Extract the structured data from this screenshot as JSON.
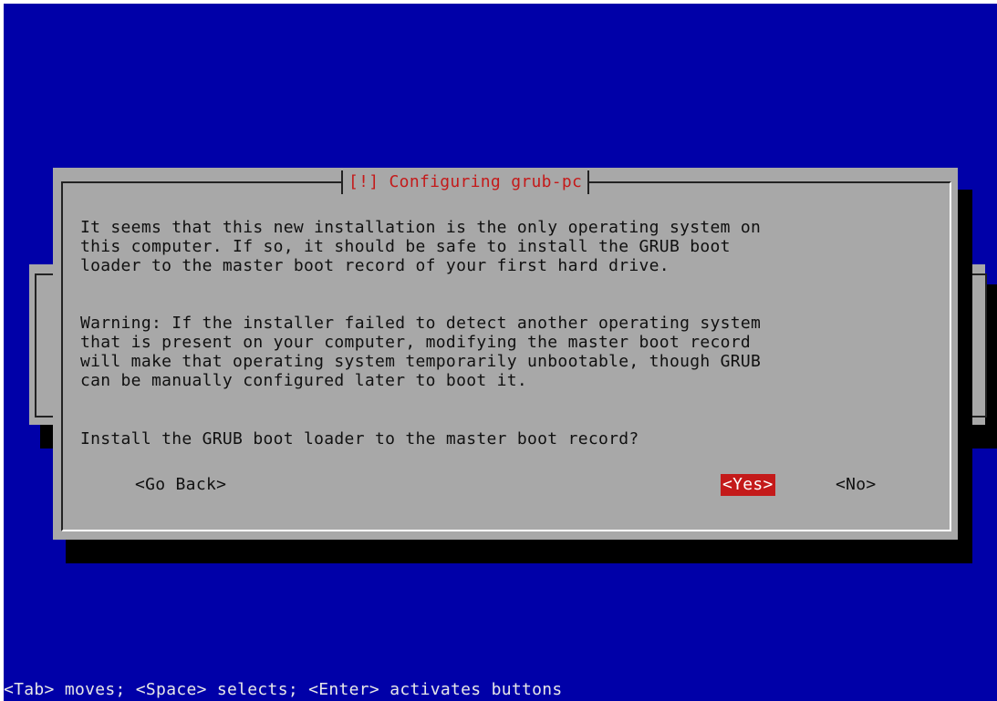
{
  "dialog": {
    "title": "[!] Configuring grub-pc",
    "paragraph_1": "It seems that this new installation is the only operating system on\nthis computer. If so, it should be safe to install the GRUB boot\nloader to the master boot record of your first hard drive.",
    "paragraph_2": "Warning: If the installer failed to detect another operating system\nthat is present on your computer, modifying the master boot record\nwill make that operating system temporarily unbootable, though GRUB\ncan be manually configured later to boot it.",
    "question": "Install the GRUB boot loader to the master boot record?",
    "buttons": {
      "go_back": "<Go Back>",
      "yes": "<Yes>",
      "no": "<No>"
    }
  },
  "status_bar": {
    "help_text": "<Tab> moves; <Space> selects; <Enter> activates buttons"
  },
  "colors": {
    "screen_background": "#0000a8",
    "dialog_background": "#a8a8a8",
    "accent": "#c41a1a",
    "shadow": "#000000"
  }
}
